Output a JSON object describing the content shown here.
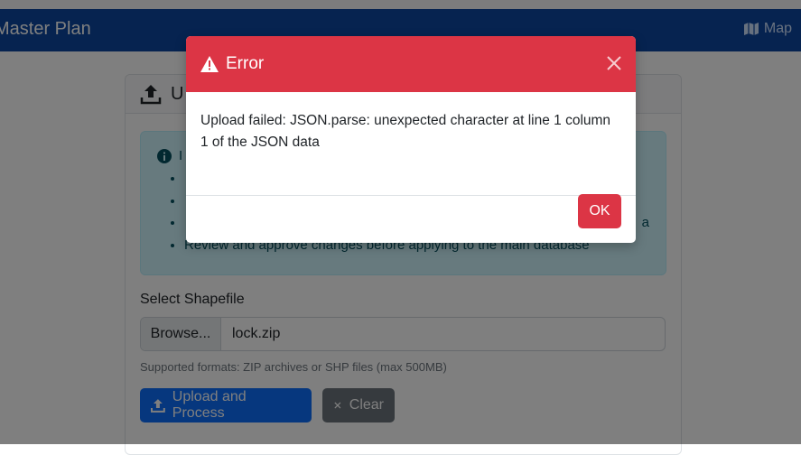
{
  "navbar": {
    "brand": "Master Plan",
    "map_link": "Map"
  },
  "card": {
    "title": "U"
  },
  "info": {
    "title": "I",
    "items": [
      "",
      "",
      "a",
      "Review and approve changes before applying to the main database"
    ]
  },
  "upload": {
    "label": "Select Shapefile",
    "browse_label": "Browse...",
    "file_name": "lock.zip",
    "hint": "Supported formats: ZIP archives or SHP files (max 500MB)",
    "upload_button": "Upload and Process",
    "clear_button": "Clear"
  },
  "modal": {
    "title": "Error",
    "message": "Upload failed: JSON.parse: unexpected character at line 1 column 1 of the JSON data",
    "ok_label": "OK"
  },
  "colors": {
    "navbar": "#0d47a1",
    "danger": "#dc3545",
    "primary": "#0d6efd",
    "secondary": "#6c757d",
    "info_bg": "#cff4fc"
  }
}
